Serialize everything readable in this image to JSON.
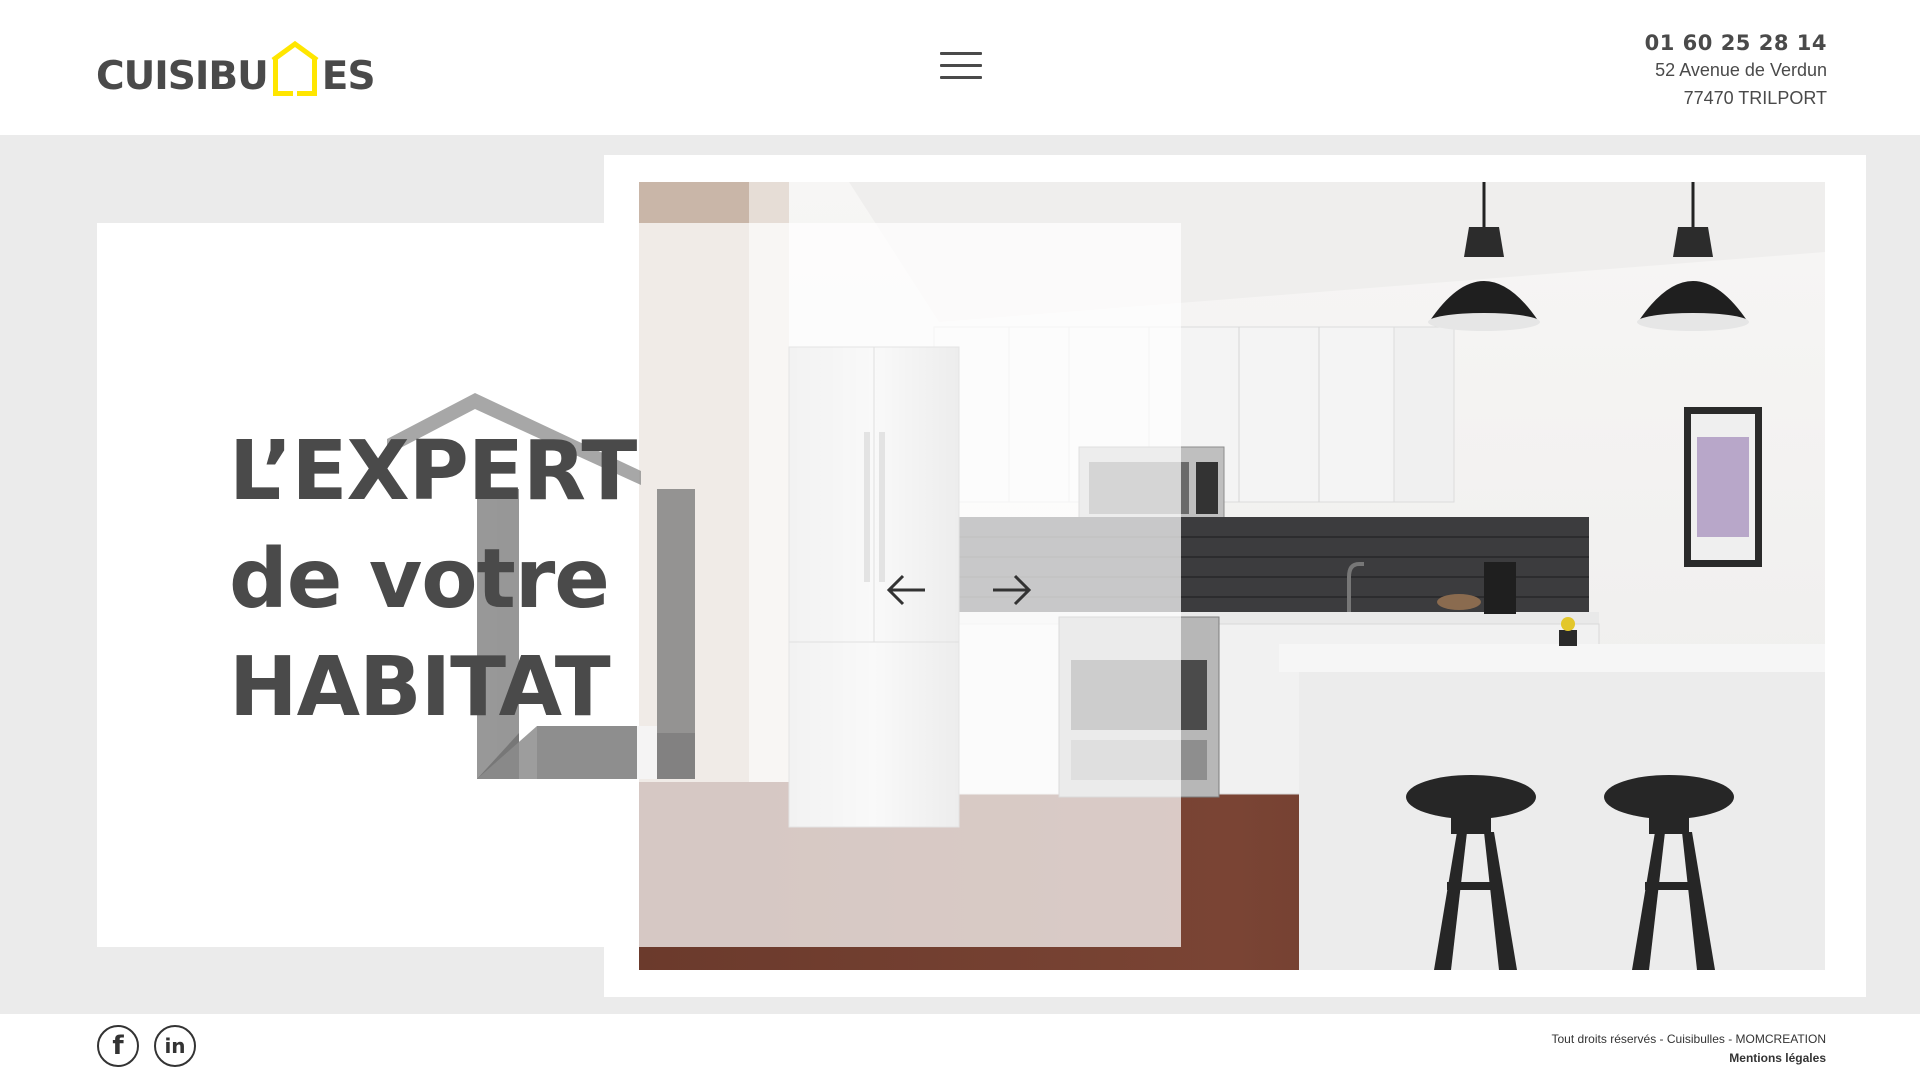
{
  "header": {
    "logo": {
      "part1": "CUISIBU",
      "part2": "ES",
      "accent_color": "#ffe600"
    },
    "menu_icon": "hamburger-menu-icon",
    "contact": {
      "phone": "01 60 25 28 14",
      "address_line1": "52 Avenue de Verdun",
      "address_line2": "77470 TRILPORT"
    }
  },
  "hero": {
    "headline": [
      "L’EXPERT",
      "de votre",
      "HABITAT"
    ],
    "prev_icon": "arrow-left-icon",
    "next_icon": "arrow-right-icon",
    "image_description_icon": "kitchen-photo"
  },
  "footer": {
    "social": [
      {
        "name": "facebook-icon",
        "glyph": "f"
      },
      {
        "name": "linkedin-icon",
        "glyph": "in"
      }
    ],
    "copyright": "Tout droits réservés - Cuisibulles - MOMCREATION",
    "legal_link": "Mentions légales"
  },
  "colors": {
    "text": "#4a4a4a",
    "background": "#ebebeb",
    "accent": "#ffe600"
  }
}
